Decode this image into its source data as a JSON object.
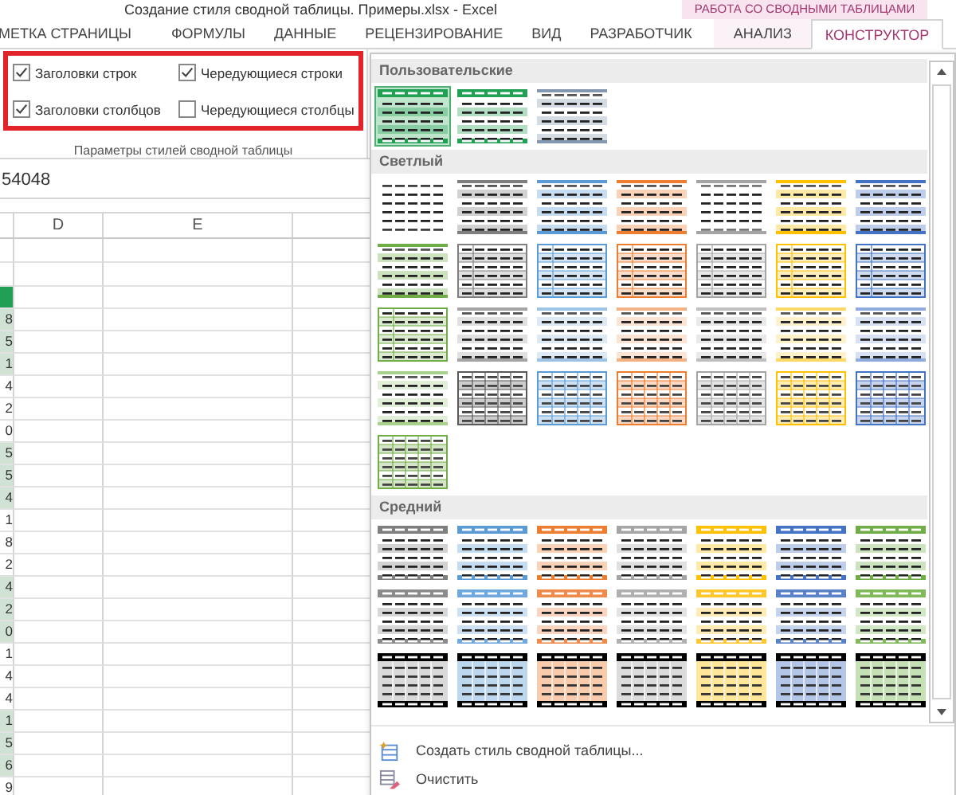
{
  "window": {
    "title": "Создание стиля сводной таблицы. Примеры.xlsx - Excel"
  },
  "context_header": "РАБОТА СО СВОДНЫМИ ТАБЛИЦАМИ",
  "tabs": [
    {
      "label": "МЕТКА СТРАНИЦЫ",
      "selected": false,
      "contextual": false
    },
    {
      "label": "ФОРМУЛЫ",
      "selected": false,
      "contextual": false
    },
    {
      "label": "ДАННЫЕ",
      "selected": false,
      "contextual": false
    },
    {
      "label": "РЕЦЕНЗИРОВАНИЕ",
      "selected": false,
      "contextual": false
    },
    {
      "label": "ВИД",
      "selected": false,
      "contextual": false
    },
    {
      "label": "РАЗРАБОТЧИК",
      "selected": false,
      "contextual": false
    },
    {
      "label": "АНАЛИЗ",
      "selected": false,
      "contextual": true
    },
    {
      "label": "КОНСТРУКТОР",
      "selected": true,
      "contextual": true
    }
  ],
  "style_options": {
    "checkboxes": [
      {
        "label": "Заголовки строк",
        "checked": true
      },
      {
        "label": "Чередующиеся строки",
        "checked": true
      },
      {
        "label": "Заголовки столбцов",
        "checked": true
      },
      {
        "label": "Чередующиеся столбцы",
        "checked": false
      }
    ],
    "group_label": "Параметры стилей сводной таблицы"
  },
  "formula_bar": {
    "value": "54048"
  },
  "sheet": {
    "columns": [
      "D",
      "E"
    ],
    "rows": [
      {
        "kind": "blank",
        "value": ""
      },
      {
        "kind": "blank",
        "value": ""
      },
      {
        "kind": "header",
        "value": ""
      },
      {
        "kind": "data",
        "value": "8",
        "shaded": true
      },
      {
        "kind": "data",
        "value": "5",
        "shaded": true
      },
      {
        "kind": "data",
        "value": "1",
        "shaded": true
      },
      {
        "kind": "data",
        "value": "4",
        "shaded": false
      },
      {
        "kind": "data",
        "value": "2",
        "shaded": false
      },
      {
        "kind": "data",
        "value": "0",
        "shaded": false
      },
      {
        "kind": "data",
        "value": "5",
        "shaded": true
      },
      {
        "kind": "data",
        "value": "5",
        "shaded": true
      },
      {
        "kind": "data",
        "value": "4",
        "shaded": true
      },
      {
        "kind": "data",
        "value": "1",
        "shaded": false
      },
      {
        "kind": "data",
        "value": "8",
        "shaded": false
      },
      {
        "kind": "data",
        "value": "2",
        "shaded": false
      },
      {
        "kind": "data",
        "value": "4",
        "shaded": true
      },
      {
        "kind": "data",
        "value": "2",
        "shaded": true
      },
      {
        "kind": "data",
        "value": "0",
        "shaded": true
      },
      {
        "kind": "data",
        "value": "1",
        "shaded": false
      },
      {
        "kind": "data",
        "value": "4",
        "shaded": false
      },
      {
        "kind": "data",
        "value": "4",
        "shaded": false
      },
      {
        "kind": "data",
        "value": "1",
        "shaded": true
      },
      {
        "kind": "data",
        "value": "5",
        "shaded": true
      },
      {
        "kind": "data",
        "value": "6",
        "shaded": true
      },
      {
        "kind": "data",
        "value": "9",
        "shaded": false
      }
    ]
  },
  "gallery": {
    "sections": [
      {
        "title": "Пользовательские",
        "items": [
          {
            "kind": "header",
            "color": "#21a055",
            "selected": true
          },
          {
            "kind": "header",
            "color": "#21a055",
            "selected": false
          },
          {
            "kind": "bands",
            "color": "#8497b0",
            "selected": false
          }
        ]
      },
      {
        "title": "Светлый",
        "items": [
          {
            "kind": "plain",
            "color": "#404040",
            "selected": false
          },
          {
            "kind": "bands",
            "color": "#7f7f7f",
            "selected": false
          },
          {
            "kind": "bands",
            "color": "#5b9bd5",
            "selected": false
          },
          {
            "kind": "bands",
            "color": "#ed7d31",
            "selected": false
          },
          {
            "kind": "lines",
            "color": "#a5a5a5",
            "selected": false
          },
          {
            "kind": "bands",
            "color": "#ffc000",
            "selected": false
          },
          {
            "kind": "bands",
            "color": "#4472c4",
            "selected": false
          },
          {
            "kind": "bands",
            "color": "#70ad47",
            "selected": false
          },
          {
            "kind": "outline",
            "color": "#7f7f7f",
            "selected": false
          },
          {
            "kind": "outline",
            "color": "#5b9bd5",
            "selected": false
          },
          {
            "kind": "outline",
            "color": "#ed7d31",
            "selected": false
          },
          {
            "kind": "outline",
            "color": "#a5a5a5",
            "selected": false
          },
          {
            "kind": "outline",
            "color": "#ffc000",
            "selected": false
          },
          {
            "kind": "outline",
            "color": "#4472c4",
            "selected": false
          },
          {
            "kind": "outline",
            "color": "#70ad47",
            "selected": false
          },
          {
            "kind": "bands",
            "color": "#a5a5a5",
            "selected": false
          },
          {
            "kind": "bands",
            "color": "#9dc3e6",
            "selected": false
          },
          {
            "kind": "bands",
            "color": "#f4b183",
            "selected": false
          },
          {
            "kind": "bands",
            "color": "#bfbfbf",
            "selected": false
          },
          {
            "kind": "bands",
            "color": "#ffd966",
            "selected": false
          },
          {
            "kind": "bands",
            "color": "#8faadc",
            "selected": false
          },
          {
            "kind": "bands",
            "color": "#a9d18e",
            "selected": false
          },
          {
            "kind": "grid",
            "color": "#595959",
            "selected": false
          },
          {
            "kind": "grid",
            "color": "#5b9bd5",
            "selected": false
          },
          {
            "kind": "grid",
            "color": "#ed7d31",
            "selected": false
          },
          {
            "kind": "grid",
            "color": "#a5a5a5",
            "selected": false
          },
          {
            "kind": "grid",
            "color": "#ffc000",
            "selected": false
          },
          {
            "kind": "grid",
            "color": "#4472c4",
            "selected": false
          },
          {
            "kind": "grid",
            "color": "#70ad47",
            "selected": false
          }
        ]
      },
      {
        "title": "Средний",
        "items": [
          {
            "kind": "header",
            "color": "#7f7f7f",
            "selected": false
          },
          {
            "kind": "header",
            "color": "#5b9bd5",
            "selected": false
          },
          {
            "kind": "header",
            "color": "#ed7d31",
            "selected": false
          },
          {
            "kind": "header",
            "color": "#a5a5a5",
            "selected": false
          },
          {
            "kind": "header",
            "color": "#ffc000",
            "selected": false
          },
          {
            "kind": "header",
            "color": "#4472c4",
            "selected": false
          },
          {
            "kind": "header",
            "color": "#70ad47",
            "selected": false
          },
          {
            "kind": "header",
            "color": "#8c8c8c",
            "selected": false
          },
          {
            "kind": "header",
            "color": "#6fa8dc",
            "selected": false
          },
          {
            "kind": "header",
            "color": "#f08a4b",
            "selected": false
          },
          {
            "kind": "header",
            "color": "#b0b0b0",
            "selected": false
          },
          {
            "kind": "header",
            "color": "#ffc72c",
            "selected": false
          },
          {
            "kind": "header",
            "color": "#5a82c8",
            "selected": false
          },
          {
            "kind": "header",
            "color": "#7fb95a",
            "selected": false
          },
          {
            "kind": "dark",
            "color": "#d9d9d9",
            "selected": false
          },
          {
            "kind": "dark",
            "color": "#bdd7ee",
            "selected": false
          },
          {
            "kind": "dark",
            "color": "#f8cbad",
            "selected": false
          },
          {
            "kind": "dark",
            "color": "#dbdbdb",
            "selected": false
          },
          {
            "kind": "dark",
            "color": "#ffe699",
            "selected": false
          },
          {
            "kind": "dark",
            "color": "#b4c6e7",
            "selected": false
          },
          {
            "kind": "dark",
            "color": "#c5e0b4",
            "selected": false
          }
        ]
      }
    ],
    "menu": [
      {
        "kind": "new",
        "label": "Создать стиль сводной таблицы..."
      },
      {
        "kind": "clear",
        "label": "Очистить"
      }
    ]
  }
}
